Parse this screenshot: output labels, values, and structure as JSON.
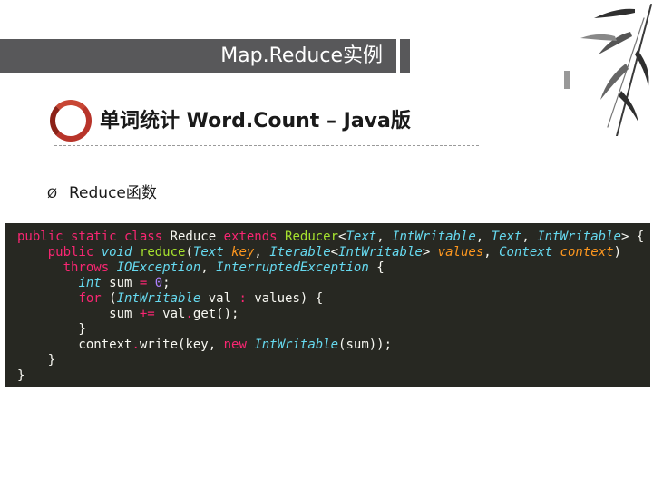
{
  "header": {
    "title": "Map.Reduce实例"
  },
  "section": {
    "subtitle": "单词统计 Word.Count – Java版"
  },
  "bullet": {
    "marker": "Ø",
    "text": "Reduce函数"
  },
  "code": {
    "lines": [
      [
        [
          "kw",
          "public static class "
        ],
        [
          "pl",
          "Reduce "
        ],
        [
          "kw",
          "extends "
        ],
        [
          "fn",
          "Reducer"
        ],
        [
          "pl",
          "<"
        ],
        [
          "ty",
          "Text"
        ],
        [
          "pl",
          ", "
        ],
        [
          "ty",
          "IntWritable"
        ],
        [
          "pl",
          ", "
        ],
        [
          "ty",
          "Text"
        ],
        [
          "pl",
          ", "
        ],
        [
          "ty",
          "IntWritable"
        ],
        [
          "pl",
          "> {"
        ]
      ],
      [
        [
          "pl",
          "    "
        ],
        [
          "kw",
          "public "
        ],
        [
          "ty",
          "void "
        ],
        [
          "fn",
          "reduce"
        ],
        [
          "pl",
          "("
        ],
        [
          "ty",
          "Text "
        ],
        [
          "pa",
          "key"
        ],
        [
          "pl",
          ", "
        ],
        [
          "ty",
          "Iterable"
        ],
        [
          "pl",
          "<"
        ],
        [
          "ty",
          "IntWritable"
        ],
        [
          "pl",
          "> "
        ],
        [
          "pa",
          "values"
        ],
        [
          "pl",
          ", "
        ],
        [
          "ty",
          "Context "
        ],
        [
          "pa",
          "context"
        ],
        [
          "pl",
          ")"
        ]
      ],
      [
        [
          "pl",
          "      "
        ],
        [
          "kw",
          "throws "
        ],
        [
          "ty",
          "IOException"
        ],
        [
          "pl",
          ", "
        ],
        [
          "ty",
          "InterruptedException "
        ],
        [
          "pl",
          "{"
        ]
      ],
      [
        [
          "pl",
          "        "
        ],
        [
          "ty",
          "int "
        ],
        [
          "pl",
          "sum "
        ],
        [
          "kw",
          "= "
        ],
        [
          "nu",
          "0"
        ],
        [
          "pl",
          ";"
        ]
      ],
      [
        [
          "pl",
          "        "
        ],
        [
          "kw",
          "for "
        ],
        [
          "pl",
          "("
        ],
        [
          "ty",
          "IntWritable "
        ],
        [
          "pl",
          "val "
        ],
        [
          "kw",
          ": "
        ],
        [
          "pl",
          "values) {"
        ]
      ],
      [
        [
          "pl",
          "            sum "
        ],
        [
          "kw",
          "+= "
        ],
        [
          "pl",
          "val"
        ],
        [
          "kw",
          "."
        ],
        [
          "pl",
          "get();"
        ]
      ],
      [
        [
          "pl",
          "        }"
        ]
      ],
      [
        [
          "pl",
          "        context"
        ],
        [
          "kw",
          "."
        ],
        [
          "pl",
          "write(key, "
        ],
        [
          "kw",
          "new "
        ],
        [
          "ty",
          "IntWritable"
        ],
        [
          "pl",
          "(sum));"
        ]
      ],
      [
        [
          "pl",
          "    }"
        ]
      ],
      [
        [
          "pl",
          "}"
        ]
      ]
    ]
  },
  "colors": {
    "title_bar": "#58585a",
    "accent_red": "#b8342a",
    "code_bg": "#272822"
  },
  "icons": {
    "ring": "red-ring-icon",
    "bullet": "arrow-bullet-icon",
    "decoration": "bamboo-ink-icon"
  }
}
